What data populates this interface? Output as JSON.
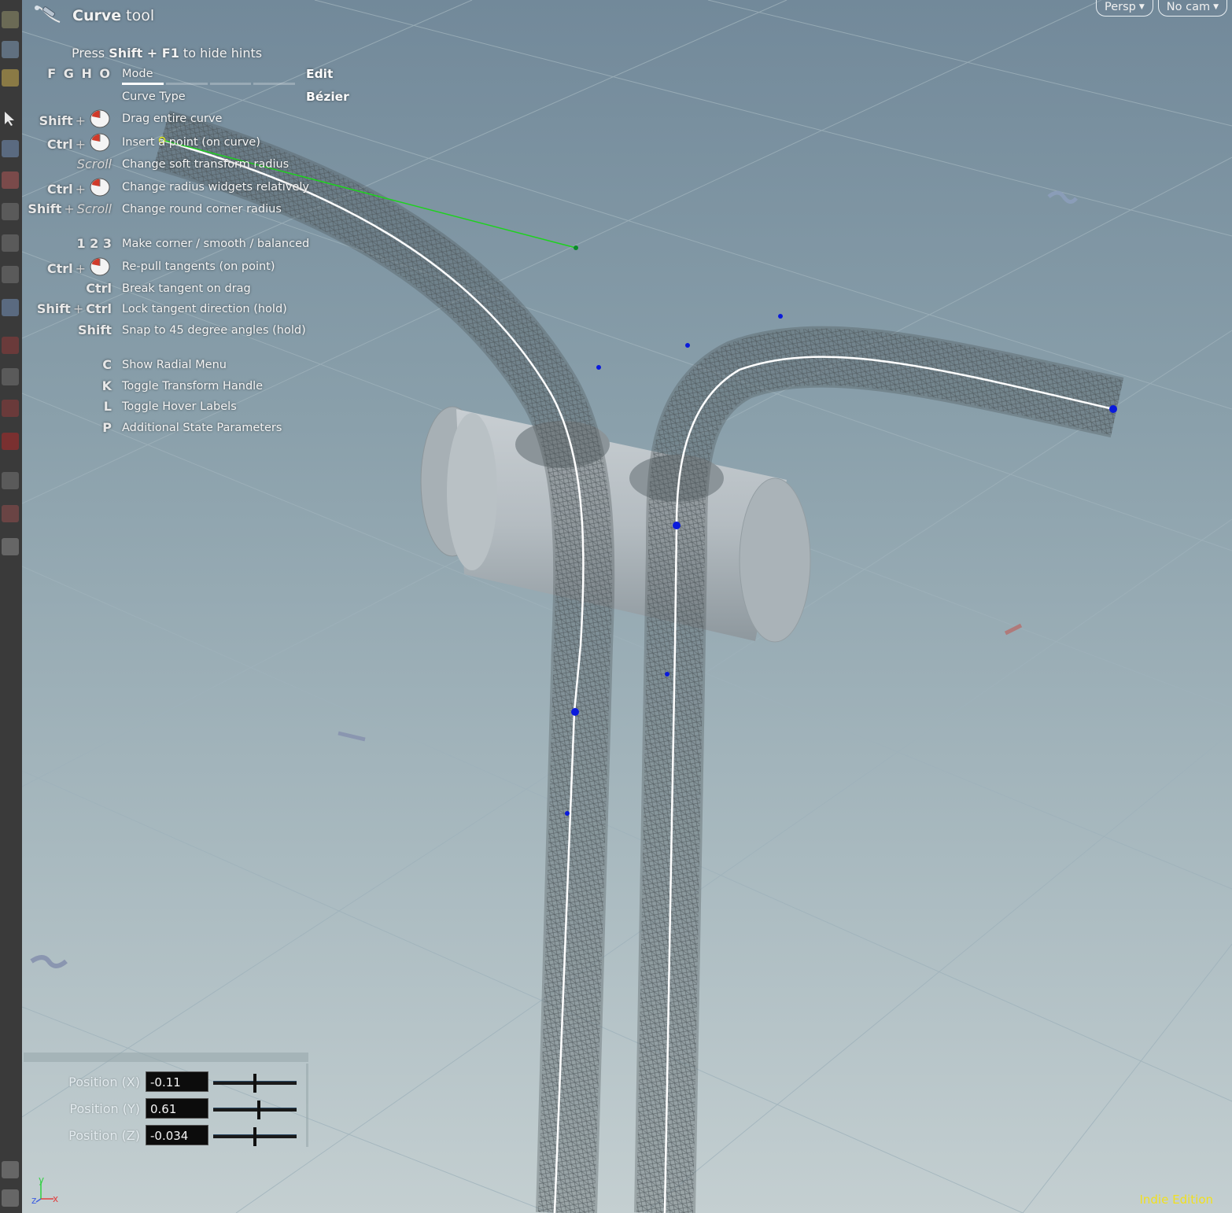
{
  "tool": {
    "title_bold": "Curve",
    "title_rest": " tool",
    "icon": "curve-tool-icon"
  },
  "hints": {
    "press_prefix": "Press ",
    "press_keys": "Shift + F1",
    "press_suffix": " to hide hints",
    "mode_keys": "F G H O",
    "mode_label": "Mode",
    "mode_value": "Edit",
    "curve_type_label": "Curve Type",
    "curve_type_value": "Bézier",
    "rows": [
      {
        "key": "Shift",
        "mouse": true,
        "desc": "Drag entire curve"
      },
      {
        "key": "Ctrl",
        "mouse": true,
        "desc": "Insert a point (on curve)"
      },
      {
        "key": "Scroll",
        "desc": "Change soft transform radius"
      },
      {
        "key": "Ctrl",
        "mouse": true,
        "desc": "Change radius widgets relatively"
      },
      {
        "key": "Shift",
        "key2": "Scroll",
        "desc": "Change round corner radius"
      },
      {
        "key": "1 2 3",
        "desc": "Make corner / smooth / balanced"
      },
      {
        "key": "Ctrl",
        "mouse": true,
        "desc": "Re-pull tangents (on point)"
      },
      {
        "key": "Ctrl",
        "desc": "Break tangent on drag"
      },
      {
        "key": "Shift",
        "key2": "Ctrl",
        "desc": "Lock tangent direction (hold)"
      },
      {
        "key": "Shift",
        "desc": "Snap to 45 degree angles (hold)"
      },
      {
        "key": "C",
        "desc": "Show Radial Menu"
      },
      {
        "key": "K",
        "desc": "Toggle Transform Handle"
      },
      {
        "key": "L",
        "desc": "Toggle Hover Labels"
      },
      {
        "key": "P",
        "desc": "Additional State Parameters"
      }
    ]
  },
  "camera": {
    "view": "Persp",
    "cam": "No cam"
  },
  "params": [
    {
      "label": "Position (X)",
      "value": "-0.11",
      "slider": 0.5
    },
    {
      "label": "Position (Y)",
      "value": "0.61",
      "slider": 0.55
    },
    {
      "label": "Position (Z)",
      "value": "-0.034",
      "slider": 0.5
    }
  ],
  "axes": {
    "x": "x",
    "y": "y",
    "z": "z"
  },
  "edition": "Indie Edition",
  "colors": {
    "point": "#0a1adc",
    "tangent": "#1ed21e",
    "edition": "#f0e020",
    "curve": "#ffffff"
  }
}
